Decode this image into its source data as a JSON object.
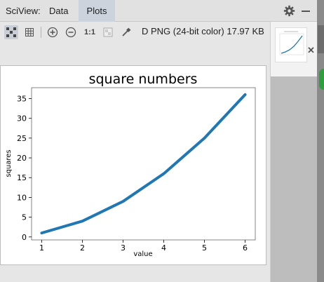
{
  "tabs": {
    "sciview_label": "SciView:",
    "data_label": "Data",
    "plots_label": "Plots"
  },
  "toolbar": {
    "actual_size_label": "1:1",
    "image_info": "D PNG (24-bit color) 17.97 KB"
  },
  "colors": {
    "line": "#1f77b4",
    "active_tab": "#ccd3dd"
  },
  "chart_data": {
    "type": "line",
    "title": "square numbers",
    "xlabel": "value",
    "ylabel": "squares",
    "x": [
      1,
      2,
      3,
      4,
      5,
      6
    ],
    "series": [
      {
        "values": [
          1,
          4,
          9,
          16,
          25,
          36
        ]
      }
    ],
    "xticks": [
      "1",
      "2",
      "3",
      "4",
      "5",
      "6"
    ],
    "yticks": [
      "0",
      "5",
      "10",
      "15",
      "20",
      "25",
      "30",
      "35"
    ],
    "xlim": [
      0.75,
      6.25
    ],
    "ylim": [
      -0.75,
      37.75
    ],
    "grid": false
  }
}
